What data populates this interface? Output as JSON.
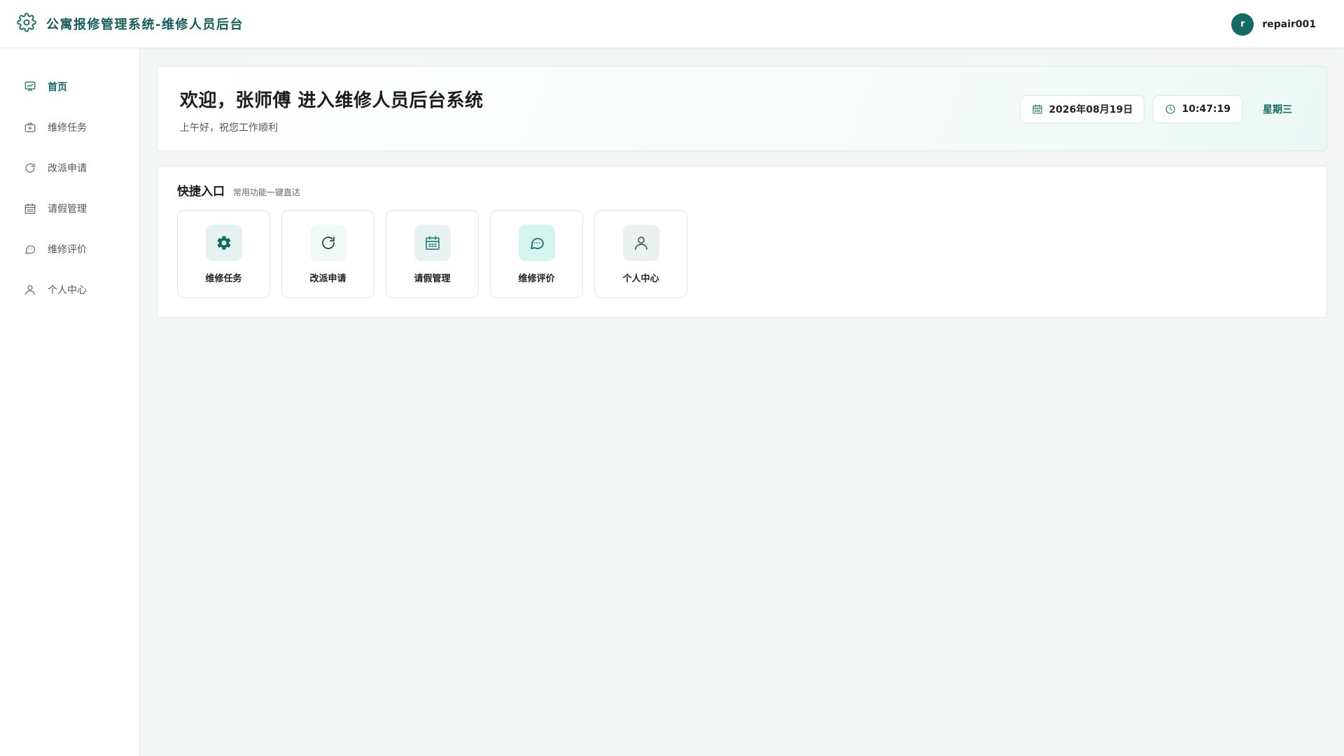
{
  "header": {
    "title": "公寓报修管理系统-维修人员后台",
    "user": {
      "avatar_letter": "r",
      "username": "repair001"
    }
  },
  "sidebar": {
    "items": [
      {
        "label": "首页",
        "icon": "dashboard-chart-icon",
        "active": true
      },
      {
        "label": "维修任务",
        "icon": "repair-task-icon"
      },
      {
        "label": "改派申请",
        "icon": "refresh-icon"
      },
      {
        "label": "请假管理",
        "icon": "calendar-icon"
      },
      {
        "label": "维修评价",
        "icon": "chat-bubble-icon"
      },
      {
        "label": "个人中心",
        "icon": "user-icon"
      }
    ]
  },
  "welcome": {
    "title": "欢迎，张师傅 进入维修人员后台系统",
    "subtitle": "上午好，祝您工作顺利",
    "date": "2026年08月19日",
    "time": "10:47:19",
    "weekday": "星期三"
  },
  "quick": {
    "title": "快捷入口",
    "subtitle": "常用功能一键直达",
    "cards": [
      {
        "label": "维修任务",
        "icon": "gear-icon",
        "bg": "#e6f2ef",
        "color": "#146b62"
      },
      {
        "label": "改派申请",
        "icon": "refresh-icon",
        "bg": "#f1f9f7",
        "color": "#333333"
      },
      {
        "label": "请假管理",
        "icon": "calendar-icon",
        "bg": "#e8f3f1",
        "color": "#2a8a7e"
      },
      {
        "label": "维修评价",
        "icon": "chat-bubble-icon",
        "bg": "#d6f5ee",
        "color": "#146b62"
      },
      {
        "label": "个人中心",
        "icon": "user-icon",
        "bg": "#eaf1ef",
        "color": "#555555"
      }
    ]
  },
  "colors": {
    "brand": "#146b62",
    "background": "#f4f6f5"
  }
}
